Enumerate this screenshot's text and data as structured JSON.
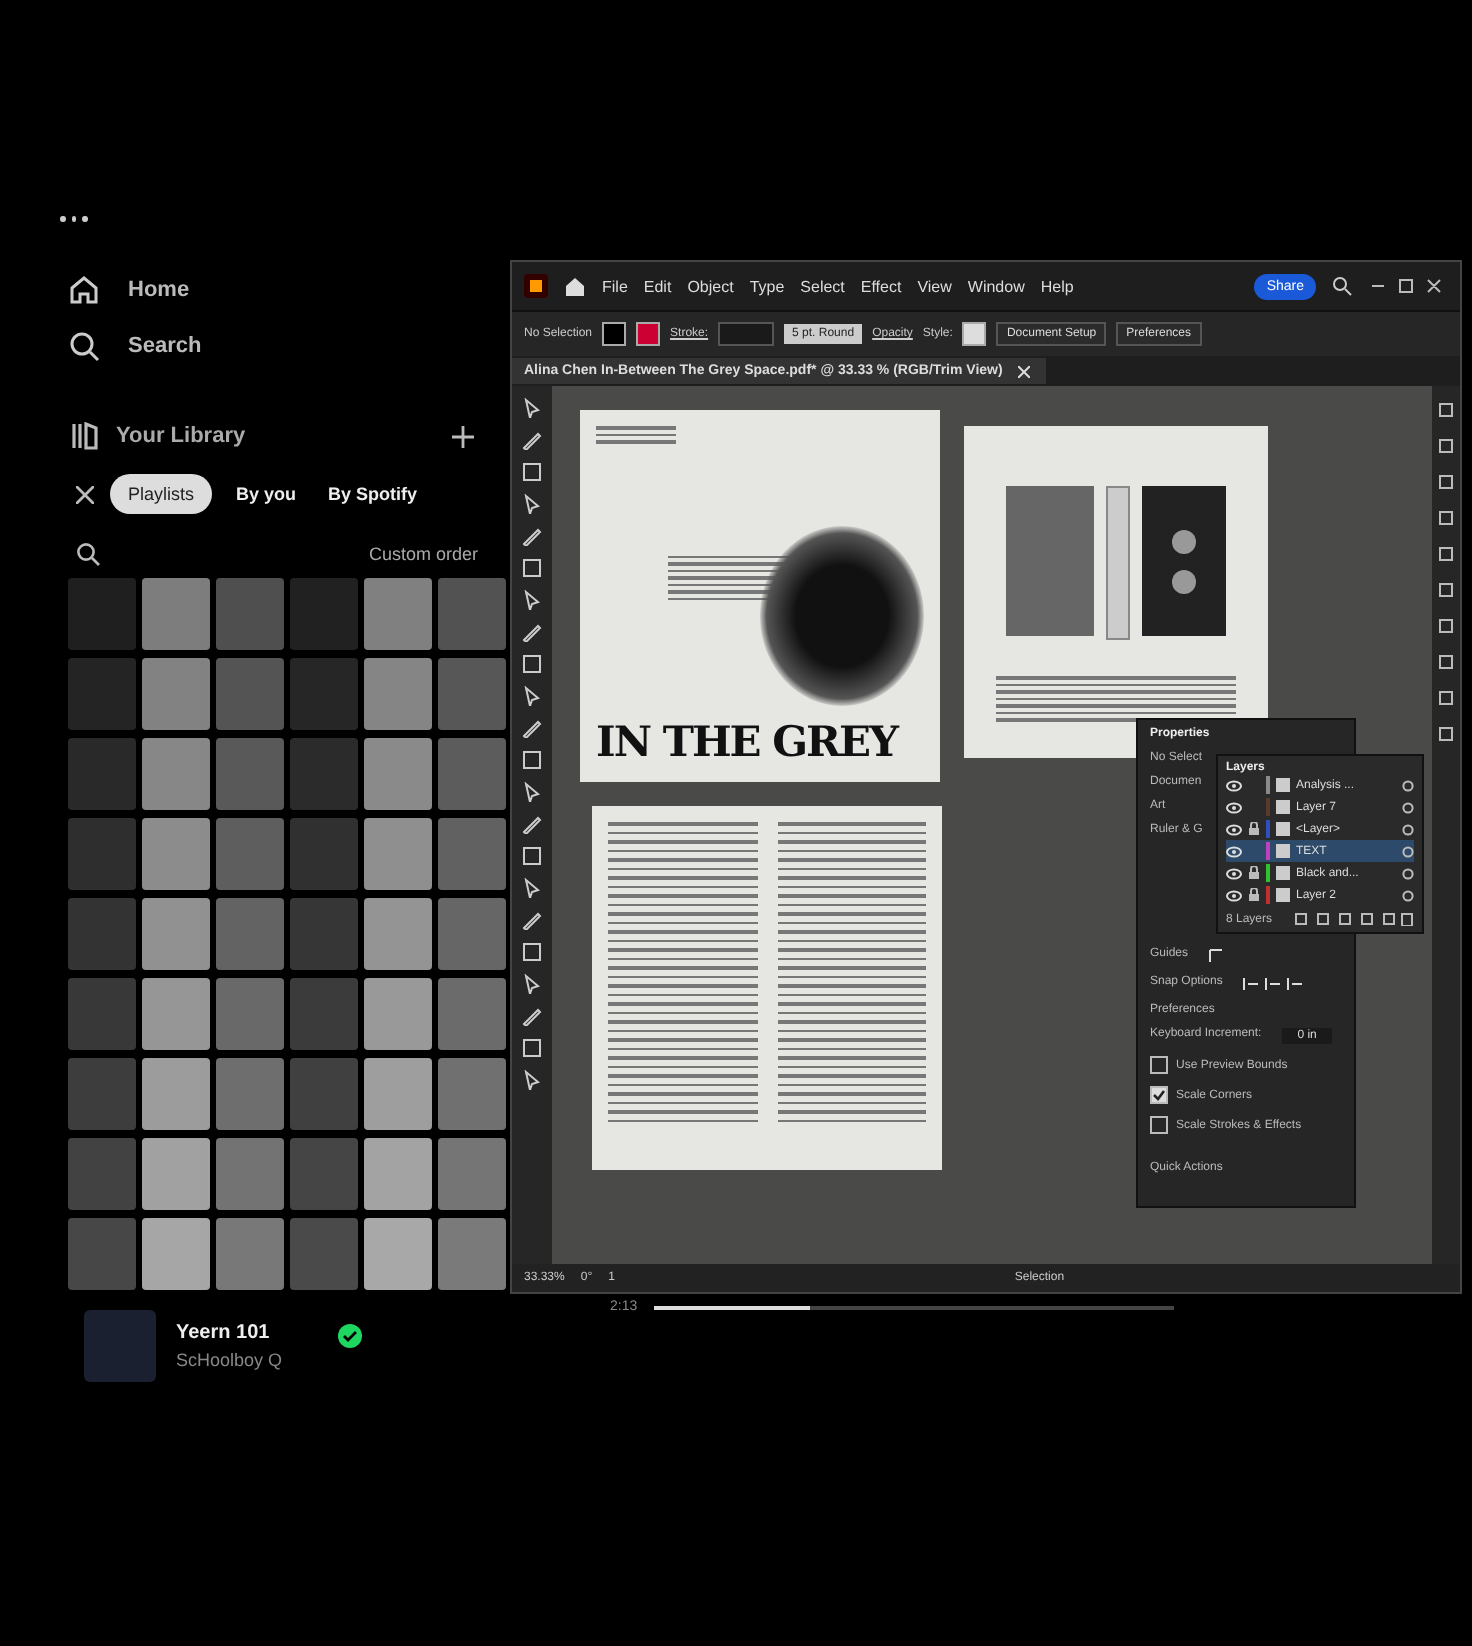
{
  "sidebar": {
    "nav": [
      {
        "label": "Home",
        "selected": false
      },
      {
        "label": "Search",
        "selected": false
      }
    ],
    "library": {
      "title": "Your Library",
      "filters": [
        {
          "label": "Playlists",
          "selected": true
        },
        {
          "label": "By you",
          "selected": false
        },
        {
          "label": "By Spotify",
          "selected": false
        }
      ],
      "sort": "Custom order"
    },
    "now_playing": {
      "title": "Yeern 101",
      "artist": "ScHoolboy Q",
      "liked": true
    }
  },
  "illustrator": {
    "menu": [
      "File",
      "Edit",
      "Object",
      "Type",
      "Select",
      "Effect",
      "View",
      "Window",
      "Help"
    ],
    "share": "Share",
    "control_bar": {
      "selection": "No Selection",
      "stroke": "Stroke:",
      "brush": "5 pt. Round",
      "opacity": "Opacity",
      "style": "Style:",
      "buttons": [
        "Document Setup",
        "Preferences"
      ]
    },
    "document_tab": "Alina Chen In-Between The Grey Space.pdf* @ 33.33 % (RGB/Trim View)",
    "artboard_heading": "IN THE GREY",
    "properties": {
      "title": "Properties",
      "rows": [
        "No Select",
        "Documen",
        "Art",
        "Ruler & G"
      ],
      "guides": "Guides",
      "snap": "Snap Options",
      "preferences": "Preferences",
      "increment_label": "Keyboard Increment:",
      "increment_value": "0 in",
      "options": [
        {
          "label": "Use Preview Bounds",
          "checked": false
        },
        {
          "label": "Scale Corners",
          "checked": true
        },
        {
          "label": "Scale Strokes & Effects",
          "checked": false
        }
      ],
      "quick_actions": "Quick Actions"
    },
    "layers": {
      "title": "Layers",
      "count": "8 Layers",
      "items": [
        {
          "name": "Analysis ...",
          "color": "#8a8a8a",
          "locked": false,
          "selected": false
        },
        {
          "name": "Layer 7",
          "color": "#5a3a2a",
          "locked": false,
          "selected": false
        },
        {
          "name": "<Layer>",
          "color": "#3050c0",
          "locked": true,
          "selected": false
        },
        {
          "name": "TEXT",
          "color": "#c040c0",
          "locked": false,
          "selected": true
        },
        {
          "name": "Black and...",
          "color": "#30c030",
          "locked": true,
          "selected": false
        },
        {
          "name": "Layer 2",
          "color": "#c03030",
          "locked": true,
          "selected": false
        }
      ]
    },
    "status": {
      "zoom": "33.33%",
      "rotation": "0°",
      "artboard": "1",
      "tool": "Selection"
    }
  },
  "playback": {
    "time": "2:13",
    "level": 0.3
  }
}
